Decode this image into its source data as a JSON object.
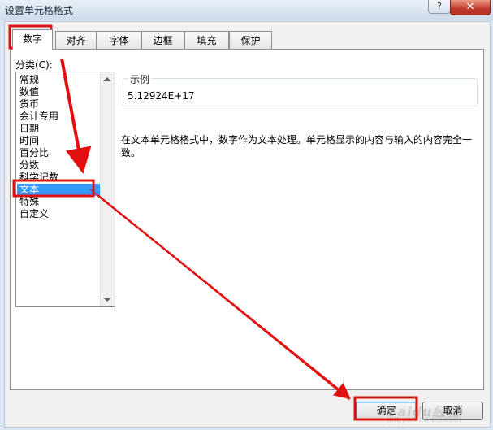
{
  "window": {
    "title": "设置单元格格式",
    "help_label": "?",
    "close_label": "✕"
  },
  "tabs": [
    {
      "label": "数字",
      "active": true
    },
    {
      "label": "对齐",
      "active": false
    },
    {
      "label": "字体",
      "active": false
    },
    {
      "label": "边框",
      "active": false
    },
    {
      "label": "填充",
      "active": false
    },
    {
      "label": "保护",
      "active": false
    }
  ],
  "category": {
    "label": "分类(C):",
    "items": [
      "常规",
      "数值",
      "货币",
      "会计专用",
      "日期",
      "时间",
      "百分比",
      "分数",
      "科学记数",
      "文本",
      "特殊",
      "自定义"
    ],
    "selected": "文本"
  },
  "sample": {
    "legend": "示例",
    "value": "5.12924E+17"
  },
  "description": "在文本单元格格式中，数字作为文本处理。单元格显示的内容与输入的内容完全一致。",
  "buttons": {
    "ok_label": "确定",
    "cancel_label": "取消"
  },
  "watermark": {
    "text": "Baidu经验",
    "url": "jingyan.baidu.com"
  },
  "annotation": {
    "highlight_color": "#e01010"
  }
}
